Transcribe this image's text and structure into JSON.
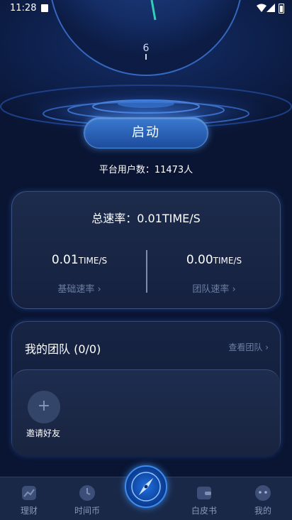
{
  "status_bar": {
    "time": "11:28"
  },
  "clock": {
    "numeral": "6"
  },
  "start_button": {
    "label": "启动"
  },
  "user_count": {
    "text": "平台用户数：11473人"
  },
  "rate_card": {
    "total": "总速率：0.01TIME/S",
    "base": {
      "value": "0.01",
      "unit": "TIME/S",
      "label": "基础速率 ›"
    },
    "team": {
      "value": "0.00",
      "unit": "TIME/S",
      "label": "团队速率 ›"
    }
  },
  "team_card": {
    "title": "我的团队 (0/0)",
    "view_link": "查看团队 ›",
    "invite_icon": "+",
    "invite_label": "邀请好友"
  },
  "tabbar": {
    "items": [
      {
        "label": "理财",
        "icon": "chart-icon"
      },
      {
        "label": "时间币",
        "icon": "clock-icon"
      },
      {
        "label": "",
        "icon": "compass-icon"
      },
      {
        "label": "白皮书",
        "icon": "wallet-icon"
      },
      {
        "label": "我的",
        "icon": "face-icon"
      }
    ]
  }
}
